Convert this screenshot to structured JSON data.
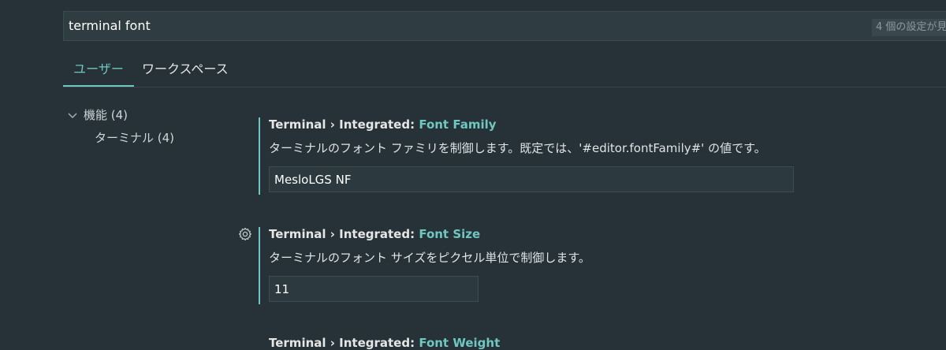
{
  "search": {
    "value": "terminal font",
    "result_count": "4 個の設定が見"
  },
  "tabs": {
    "user": "ユーザー",
    "workspace": "ワークスペース"
  },
  "tree": {
    "features": "機能 (4)",
    "terminal": "ターミナル (4)"
  },
  "settings": [
    {
      "prefix": "Terminal › Integrated: ",
      "key": "Font Family",
      "description": "ターミナルのフォント ファミリを制御します。既定では、'#editor.fontFamily#' の値です。",
      "value": "MesloLGS NF"
    },
    {
      "prefix": "Terminal › Integrated: ",
      "key": "Font Size",
      "description": "ターミナルのフォント サイズをピクセル単位で制御します。",
      "value": "11"
    },
    {
      "prefix": "Terminal › Integrated: ",
      "key": "Font Weight"
    }
  ],
  "icons": {
    "gear": "gear-icon",
    "chevron": "chevron-down-icon"
  },
  "colors": {
    "background": "#263238",
    "accent": "#6fc7c0"
  }
}
